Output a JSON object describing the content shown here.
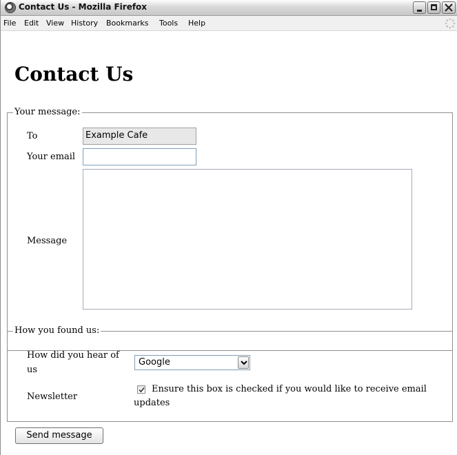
{
  "window": {
    "title": "Contact Us - Mozilla Firefox"
  },
  "menu": {
    "items": [
      "File",
      "Edit",
      "View",
      "History",
      "Bookmarks",
      "Tools",
      "Help"
    ]
  },
  "page": {
    "heading": "Contact Us"
  },
  "message_section": {
    "legend": "Your message:",
    "to_label": "To",
    "to_value": "Example Cafe",
    "email_label": "Your email",
    "email_value": "",
    "message_label": "Message",
    "message_value": ""
  },
  "found_section": {
    "legend": "How you found us:",
    "hear_label": "How did you hear of us",
    "hear_selected": "Google",
    "newsletter_label": "Newsletter",
    "newsletter_checked": true,
    "newsletter_text": "Ensure this box is checked if you would like to receive email updates"
  },
  "actions": {
    "send_label": "Send message"
  }
}
